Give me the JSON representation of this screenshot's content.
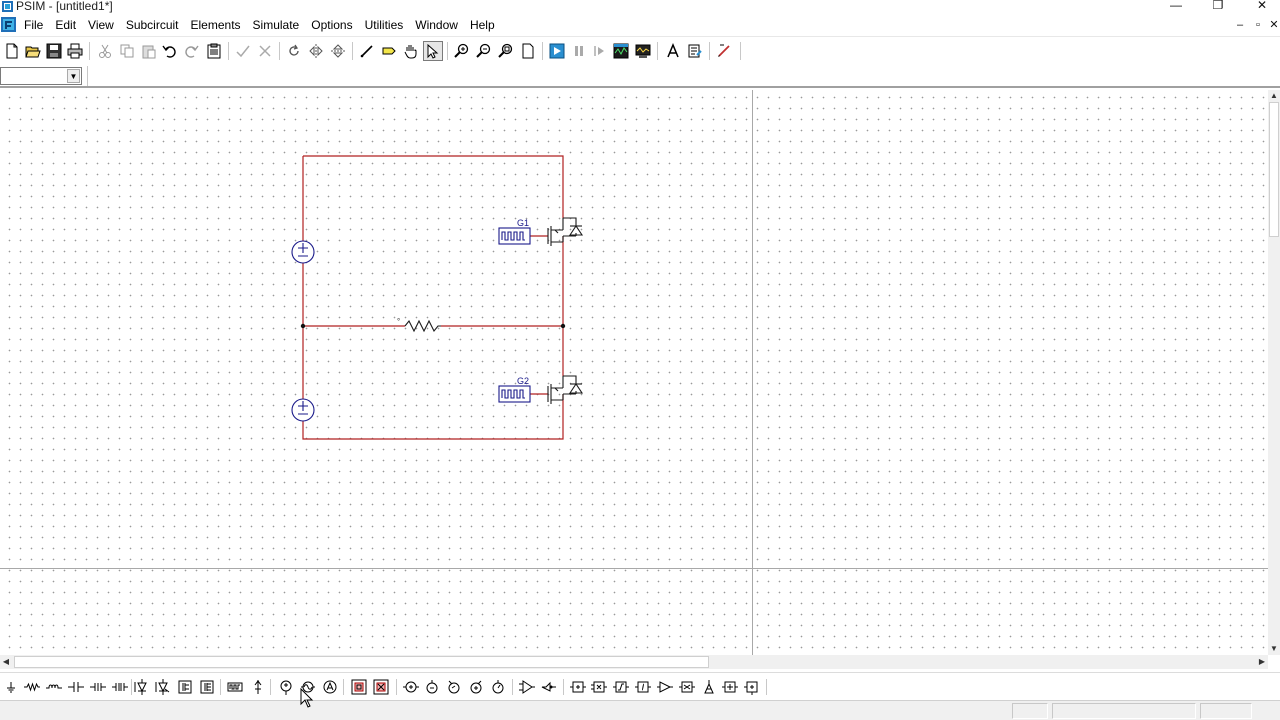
{
  "window": {
    "title": "PSIM - [untitled1*]",
    "minimize": "—",
    "maximize": "❐",
    "close": "✕"
  },
  "menu": {
    "items": [
      "File",
      "Edit",
      "View",
      "Subcircuit",
      "Elements",
      "Simulate",
      "Options",
      "Utilities",
      "Window",
      "Help"
    ],
    "mdi_minimize": "–",
    "mdi_restore": "▫",
    "mdi_close": "✕"
  },
  "combo": {
    "value": ""
  },
  "schematic": {
    "labels": {
      "g1": "G1",
      "g2": "G2",
      "resistor_mark": "°"
    },
    "wire_color": "#b02020",
    "component_color": "#1a1a8a",
    "dot_color": "#9a9a9a"
  },
  "toolbar_icons": [
    "new-icon",
    "open-icon",
    "save-icon",
    "print-icon",
    "cut-icon",
    "copy-icon",
    "paste-icon",
    "undo-icon",
    "redo-icon",
    "clipboard-icon",
    "check-icon",
    "cross-icon",
    "rotate-icon",
    "flip-lr-icon",
    "flip-tb-icon",
    "wire-icon",
    "label-icon",
    "pan-icon",
    "select-icon",
    "zoom-in-icon",
    "zoom-out-icon",
    "zoom-fit-icon",
    "page-icon",
    "run-simulation-icon",
    "pause-icon",
    "step-icon",
    "simview-icon",
    "scope-icon",
    "text-icon",
    "properties-icon",
    "draw-icon"
  ],
  "element_icons": [
    "ground-icon",
    "resistor-icon",
    "inductor-icon",
    "capacitor-icon",
    "rl-branch-icon",
    "rlc-branch-icon",
    "diode-icon",
    "thyristor-icon",
    "igbt-icon",
    "mosfet-icon",
    "switch-controller-icon",
    "voltage-probe-icon",
    "dc-voltage-source-icon",
    "ac-voltage-source-icon",
    "ammeter-icon",
    "transformer-icon",
    "coupled-inductor-icon",
    "voltmeter-icon",
    "current-probe-icon",
    "speed-sensor-icon",
    "torque-sensor-icon",
    "position-sensor-icon",
    "comparator-icon",
    "gating-block-icon",
    "summer-icon",
    "multiplier-icon",
    "limiter-icon",
    "integrator-icon",
    "differentiator-icon",
    "filter-icon",
    "op-amp-icon",
    "zoh-icon",
    "pi-controller-icon"
  ]
}
